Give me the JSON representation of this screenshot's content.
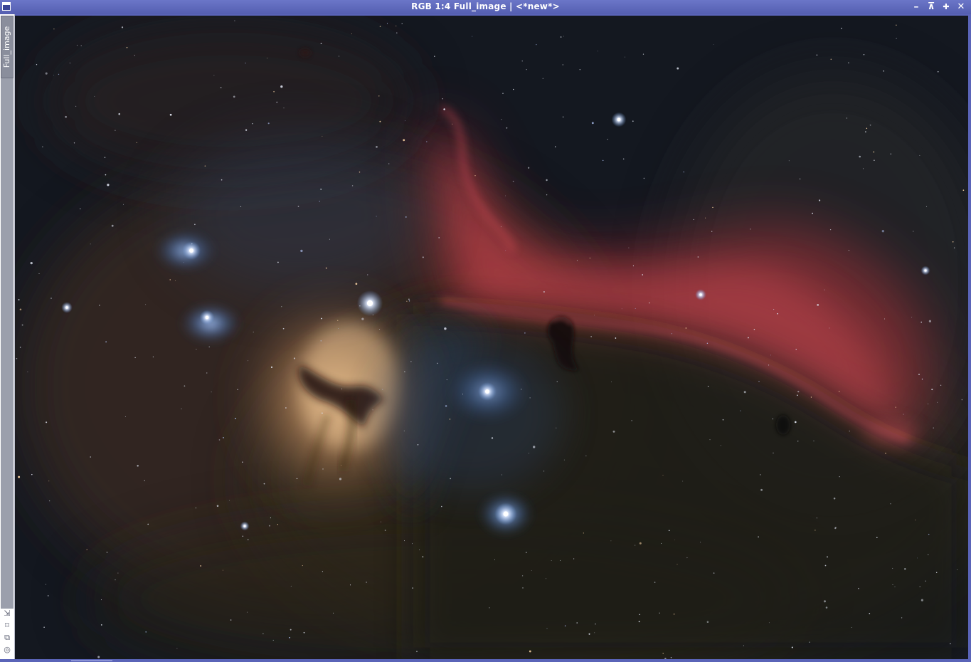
{
  "window": {
    "title": "RGB 1:4 Full_image | <*new*>",
    "icons": {
      "app": "view-window-icon",
      "minimize": "minimize-icon",
      "shade": "shade-icon",
      "maximize": "maximize-icon",
      "close": "close-icon"
    },
    "buttons": {
      "minimize_glyph": "━",
      "shade_glyph": "⊼",
      "maximize_glyph": "✚",
      "close_glyph": "✕"
    }
  },
  "sidebar": {
    "tab_label": "Full_image",
    "tools": [
      {
        "name": "pan-icon",
        "glyph": "⇲"
      },
      {
        "name": "fit-view-icon",
        "glyph": "⌑"
      },
      {
        "name": "clone-view-icon",
        "glyph": "⧉"
      },
      {
        "name": "preview-target-icon",
        "glyph": "◎"
      }
    ]
  },
  "image": {
    "subject": "horsehead-and-flame-nebula-image",
    "colors": {
      "background": "#121620",
      "red_emission": "#c4424a",
      "flame_core": "#e0b080",
      "blue_reflection": "#6a96d8",
      "dust": "#3a2e24"
    }
  }
}
